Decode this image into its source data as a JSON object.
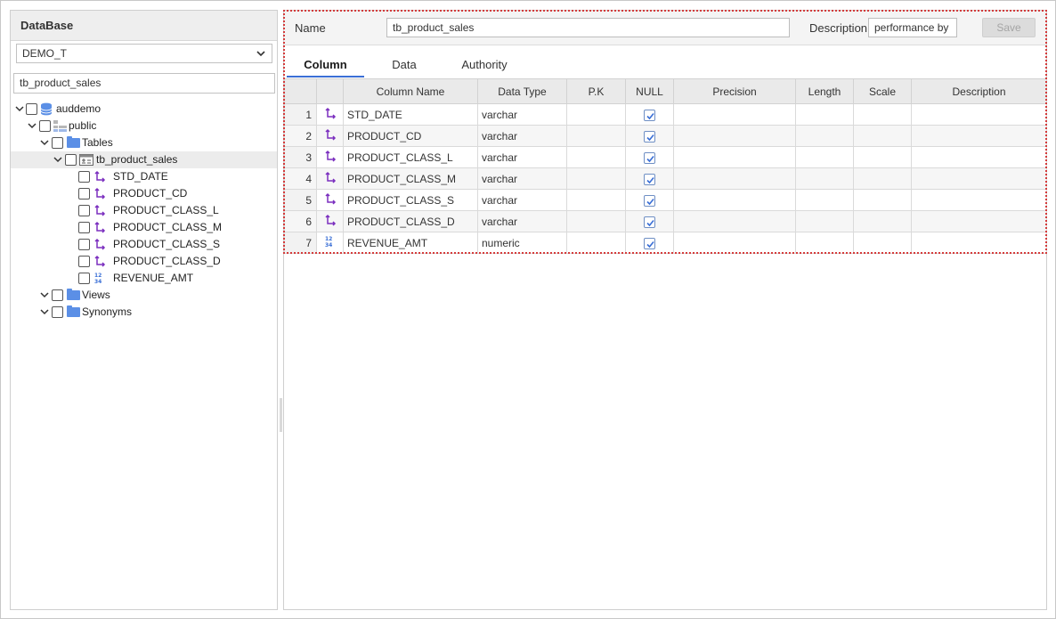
{
  "left_panel": {
    "header": "DataBase",
    "db_select": "DEMO_T",
    "search_value": "tb_product_sales",
    "tree": {
      "root": "auddemo",
      "schema": "public",
      "tables_folder": "Tables",
      "table": "tb_product_sales",
      "columns": [
        {
          "name": "STD_DATE",
          "type_icon": "varchar-icon"
        },
        {
          "name": "PRODUCT_CD",
          "type_icon": "varchar-icon"
        },
        {
          "name": "PRODUCT_CLASS_L",
          "type_icon": "varchar-icon"
        },
        {
          "name": "PRODUCT_CLASS_M",
          "type_icon": "varchar-icon"
        },
        {
          "name": "PRODUCT_CLASS_S",
          "type_icon": "varchar-icon"
        },
        {
          "name": "PRODUCT_CLASS_D",
          "type_icon": "varchar-icon"
        },
        {
          "name": "REVENUE_AMT",
          "type_icon": "numeric-icon"
        }
      ],
      "views_folder": "Views",
      "synonyms_folder": "Synonyms"
    }
  },
  "right_panel": {
    "name_label": "Name",
    "name_value": "tb_product_sales",
    "description_label": "Description",
    "description_value": "performance by",
    "save_label": "Save",
    "tabs": [
      "Column",
      "Data",
      "Authority"
    ],
    "active_tab": "Column",
    "grid": {
      "headers": [
        "",
        "",
        "Column Name",
        "Data Type",
        "P.K",
        "NULL",
        "Precision",
        "Length",
        "Scale",
        "Description"
      ],
      "rows": [
        {
          "no": "1",
          "icon": "varchar-icon",
          "name": "STD_DATE",
          "type": "varchar",
          "pk": "",
          "null": true,
          "precision": "",
          "length": "",
          "scale": "",
          "desc": ""
        },
        {
          "no": "2",
          "icon": "varchar-icon",
          "name": "PRODUCT_CD",
          "type": "varchar",
          "pk": "",
          "null": true,
          "precision": "",
          "length": "",
          "scale": "",
          "desc": ""
        },
        {
          "no": "3",
          "icon": "varchar-icon",
          "name": "PRODUCT_CLASS_L",
          "type": "varchar",
          "pk": "",
          "null": true,
          "precision": "",
          "length": "",
          "scale": "",
          "desc": ""
        },
        {
          "no": "4",
          "icon": "varchar-icon",
          "name": "PRODUCT_CLASS_M",
          "type": "varchar",
          "pk": "",
          "null": true,
          "precision": "",
          "length": "",
          "scale": "",
          "desc": ""
        },
        {
          "no": "5",
          "icon": "varchar-icon",
          "name": "PRODUCT_CLASS_S",
          "type": "varchar",
          "pk": "",
          "null": true,
          "precision": "",
          "length": "",
          "scale": "",
          "desc": ""
        },
        {
          "no": "6",
          "icon": "varchar-icon",
          "name": "PRODUCT_CLASS_D",
          "type": "varchar",
          "pk": "",
          "null": true,
          "precision": "",
          "length": "",
          "scale": "",
          "desc": ""
        },
        {
          "no": "7",
          "icon": "numeric-icon",
          "name": "REVENUE_AMT",
          "type": "numeric",
          "pk": "",
          "null": true,
          "precision": "",
          "length": "",
          "scale": "",
          "desc": ""
        }
      ]
    }
  },
  "colors": {
    "accent": "#3a6fd6",
    "highlight_border": "#d43b3b",
    "varchar_icon": "#7b2fbf",
    "folder": "#5b8fe6"
  }
}
